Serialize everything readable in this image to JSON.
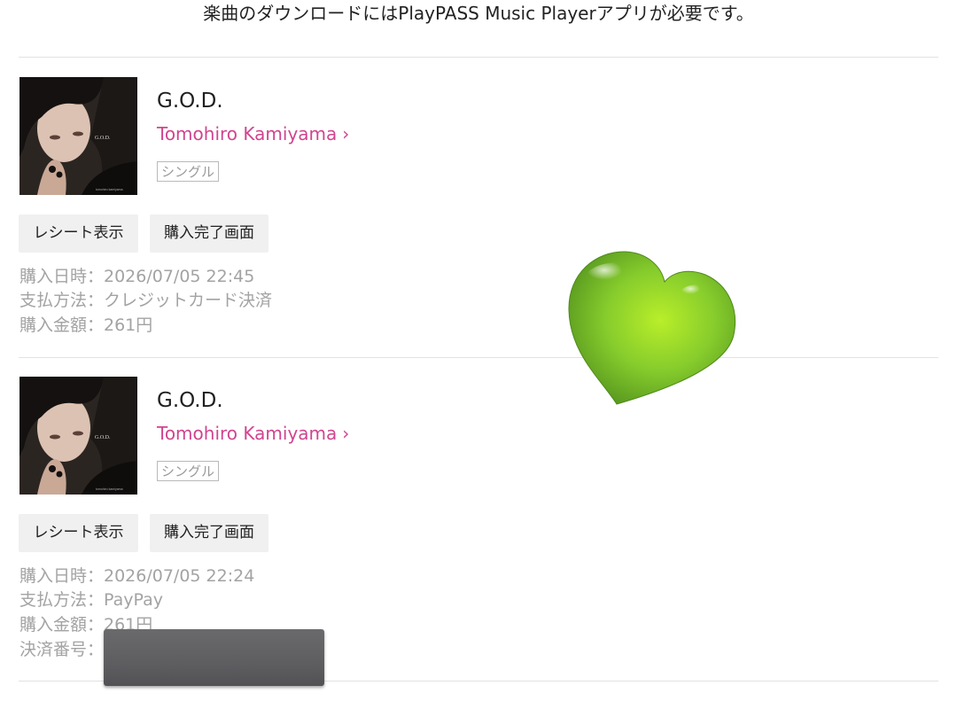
{
  "notice": "楽曲のダウンロードにはPlayPASS Music Playerアプリが必要です。",
  "purchases": [
    {
      "title": "G.O.D.",
      "artist": "Tomohiro Kamiyama",
      "badge": "シングル",
      "receipt_label": "レシート表示",
      "complete_label": "購入完了画面",
      "date_line": "購入日時：2026/07/05 22:45",
      "method_line": "支払方法：クレジットカード決済",
      "amount_line": "購入金額：261円"
    },
    {
      "title": "G.O.D.",
      "artist": "Tomohiro Kamiyama",
      "badge": "シングル",
      "receipt_label": "レシート表示",
      "complete_label": "購入完了画面",
      "date_line": "購入日時：2026/07/05 22:24",
      "method_line": "支払方法：PayPay",
      "amount_line": "購入金額：261円",
      "payment_no_label": "決済番号："
    }
  ],
  "cover": {
    "mini_title": "G.O.D.",
    "mini_artist": "tomohiro kamiyama"
  },
  "colors": {
    "accent": "#d1448e",
    "heart": "#8fd62e",
    "redaction": "#5f5f62"
  },
  "icons": {
    "chevron": "chevron-right-icon",
    "heart": "green-heart-icon"
  }
}
